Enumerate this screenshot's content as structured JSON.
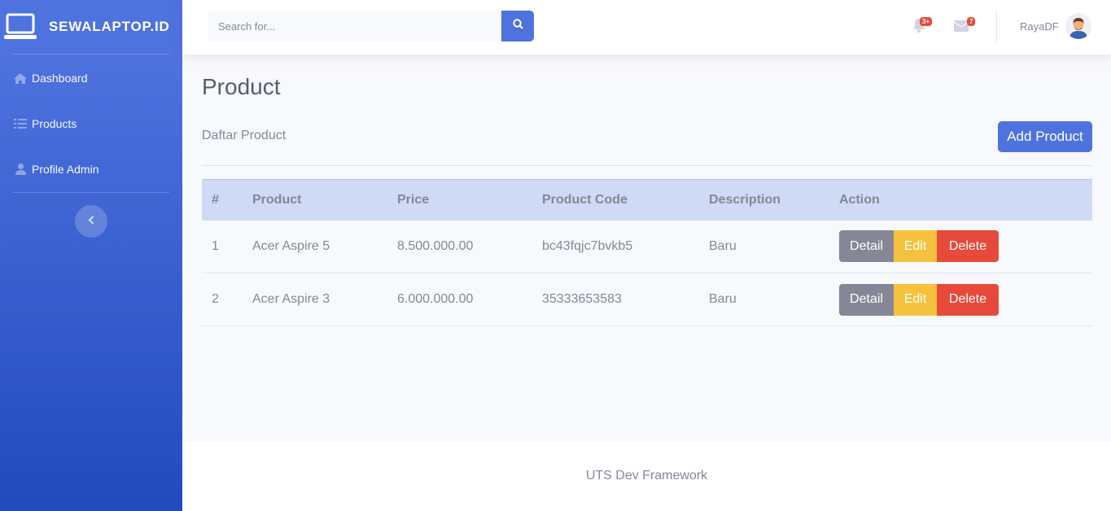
{
  "brand": {
    "name": "SEWALAPTOP.ID",
    "icon": "laptop-icon"
  },
  "sidebar": {
    "items": [
      {
        "label": "Dashboard",
        "icon": "home-icon"
      },
      {
        "label": "Products",
        "icon": "list-icon"
      },
      {
        "label": "Profile Admin",
        "icon": "user-icon"
      }
    ],
    "toggle_icon": "chevron-left-icon"
  },
  "topbar": {
    "search_placeholder": "Search for...",
    "alerts_badge": "3+",
    "messages_badge": "7",
    "user_name": "RayaDF"
  },
  "page": {
    "title": "Product",
    "subtitle": "Daftar Product",
    "add_button": "Add Product"
  },
  "table": {
    "headers": [
      "#",
      "Product",
      "Price",
      "Product Code",
      "Description",
      "Action"
    ],
    "rows": [
      {
        "no": "1",
        "product": "Acer Aspire 5",
        "price": "8.500.000.00",
        "code": "bc43fqjc7bvkb5",
        "description": "Baru"
      },
      {
        "no": "2",
        "product": "Acer Aspire 3",
        "price": "6.000.000.00",
        "code": "35333653583",
        "description": "Baru"
      }
    ],
    "actions": {
      "detail": "Detail",
      "edit": "Edit",
      "delete": "Delete"
    }
  },
  "footer": {
    "text": "UTS Dev Framework"
  },
  "colors": {
    "primary": "#4e73df",
    "secondary": "#858796",
    "warning": "#f6c23e",
    "danger": "#e74a3b"
  }
}
